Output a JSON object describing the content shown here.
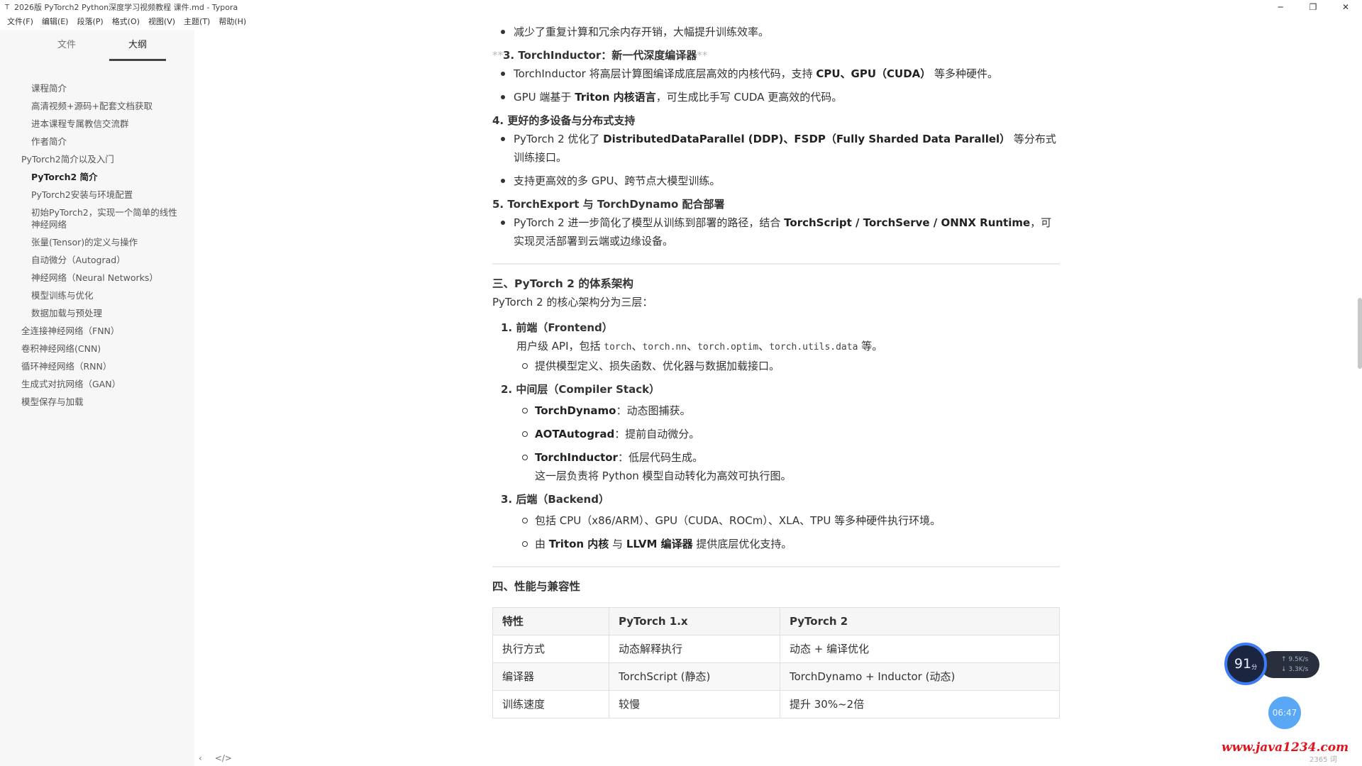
{
  "window": {
    "title": "2026版 PyTorch2 Python深度学习视频教程 课件.md - Typora",
    "app_icon": "T",
    "minimize": "─",
    "maximize": "❐",
    "close": "✕"
  },
  "menu": [
    "文件(F)",
    "编辑(E)",
    "段落(P)",
    "格式(O)",
    "视图(V)",
    "主题(T)",
    "帮助(H)"
  ],
  "sidebar": {
    "tabs": [
      "文件",
      "大纲"
    ],
    "outline": [
      {
        "label": "课程简介",
        "level": 2
      },
      {
        "label": "高清视频+源码+配套文档获取",
        "level": 2
      },
      {
        "label": "进本课程专属教信交流群",
        "level": 2
      },
      {
        "label": "作者简介",
        "level": 2
      },
      {
        "label": "PyTorch2简介以及入门",
        "level": 1
      },
      {
        "label": "PyTorch2 简介",
        "level": 2,
        "active": true
      },
      {
        "label": "PyTorch2安装与环境配置",
        "level": 2
      },
      {
        "label": "初始PyTorch2，实现一个简单的线性神经网络",
        "level": 2
      },
      {
        "label": "张量(Tensor)的定义与操作",
        "level": 2
      },
      {
        "label": "自动微分（Autograd）",
        "level": 2
      },
      {
        "label": "神经网络（Neural Networks）",
        "level": 2
      },
      {
        "label": "模型训练与优化",
        "level": 2
      },
      {
        "label": "数据加载与预处理",
        "level": 2
      },
      {
        "label": "全连接神经网络（FNN）",
        "level": 1
      },
      {
        "label": "卷积神经网络(CNN)",
        "level": 1
      },
      {
        "label": "循环神经网络（RNN）",
        "level": 1
      },
      {
        "label": "生成式对抗网络（GAN）",
        "level": 1
      },
      {
        "label": "模型保存与加载",
        "level": 1
      }
    ],
    "footer_back": "‹",
    "footer_source": "</>"
  },
  "doc": {
    "top_bullet": "减少了重复计算和冗余内存开销，大幅提升训练效率。",
    "s3_star": "**",
    "s3_title": "3. TorchInductor：新一代深度编译器",
    "s3_b1_pre": "TorchInductor 将高层计算图编译成底层高效的内核代码，支持 ",
    "s3_b1_bold": "CPU、GPU（CUDA）",
    "s3_b1_post": " 等多种硬件。",
    "s3_b2_pre": "GPU 端基于 ",
    "s3_b2_bold": "Triton 内核语言",
    "s3_b2_post": "，可生成比手写 CUDA 更高效的代码。",
    "s4_title": "4. 更好的多设备与分布式支持",
    "s4_b1_pre": "PyTorch 2 优化了 ",
    "s4_b1_bold": "DistributedDataParallel (DDP)、FSDP（Fully Sharded Data Parallel）",
    "s4_b1_post": " 等分布式训练接口。",
    "s4_b2": "支持更高效的多 GPU、跨节点大模型训练。",
    "s5_title": "5. TorchExport 与 TorchDynamo 配合部署",
    "s5_b1_pre": "PyTorch 2 进一步简化了模型从训练到部署的路径，结合 ",
    "s5_b1_bold": "TorchScript / TorchServe / ONNX Runtime",
    "s5_b1_post": "，可实现灵活部署到云端或边缘设备。",
    "arch_title": "三、PyTorch 2 的体系架构",
    "arch_intro": "PyTorch 2 的核心架构分为三层：",
    "arch_1_title": "1. 前端（Frontend）",
    "arch_1_desc_pre": "用户级 API，包括 ",
    "arch_1_code1": "torch",
    "arch_1_code2": "torch.nn",
    "arch_1_code3": "torch.optim",
    "arch_1_code4": "torch.utils.data",
    "arch_1_sep": "、",
    "arch_1_desc_post": " 等。",
    "arch_1_sub1": "提供模型定义、损失函数、优化器与数据加载接口。",
    "arch_2_title": "2. 中间层（Compiler Stack）",
    "arch_2_sub1_bold": "TorchDynamo",
    "arch_2_sub1_post": "：动态图捕获。",
    "arch_2_sub2_bold": "AOTAutograd",
    "arch_2_sub2_post": "：提前自动微分。",
    "arch_2_sub3_bold": "TorchInductor",
    "arch_2_sub3_post": "：低层代码生成。",
    "arch_2_sub3_line2": "这一层负责将 Python 模型自动转化为高效可执行图。",
    "arch_3_title": "3. 后端（Backend）",
    "arch_3_sub1": "包括 CPU（x86/ARM）、GPU（CUDA、ROCm）、XLA、TPU 等多种硬件执行环境。",
    "arch_3_sub2_pre": "由 ",
    "arch_3_sub2_bold1": "Triton 内核",
    "arch_3_sub2_mid": " 与 ",
    "arch_3_sub2_bold2": "LLVM 编译器",
    "arch_3_sub2_post": " 提供底层优化支持。",
    "perf_title": "四、性能与兼容性",
    "table": {
      "headers": [
        "特性",
        "PyTorch 1.x",
        "PyTorch 2"
      ],
      "rows": [
        [
          "执行方式",
          "动态解释执行",
          "动态 + 编译优化"
        ],
        [
          "编译器",
          "TorchScript (静态)",
          "TorchDynamo + Inductor (动态)"
        ],
        [
          "训练速度",
          "较慢",
          "提升 30%~2倍"
        ]
      ]
    }
  },
  "widget": {
    "score": "91",
    "unit": "分",
    "up": "↑ 9.5K/s",
    "down": "↓ 3.3K/s",
    "time": "06:47"
  },
  "watermark": "www.java1234.com",
  "word_count": "2365 词"
}
